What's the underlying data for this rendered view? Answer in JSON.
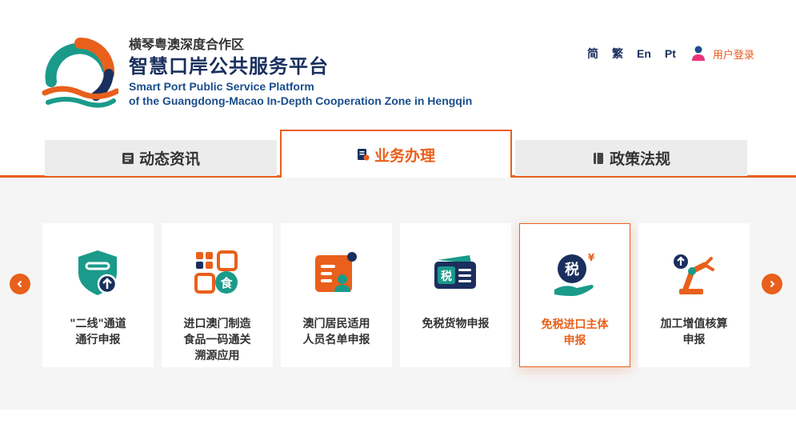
{
  "header": {
    "org_name": "横琴粤澳深度合作区",
    "platform_name": "智慧口岸公共服务平台",
    "en_line1": "Smart Port Public Service Platform",
    "en_line2": "of the Guangdong-Macao In-Depth Cooperation Zone in Hengqin",
    "languages": [
      "简",
      "繁",
      "En",
      "Pt"
    ],
    "login_label": "用户登录"
  },
  "tabs": [
    {
      "label": "动态资讯",
      "icon": "news-icon",
      "active": false
    },
    {
      "label": "业务办理",
      "icon": "business-doc-icon",
      "active": true
    },
    {
      "label": "政策法规",
      "icon": "book-icon",
      "active": false
    }
  ],
  "services": [
    {
      "label": "\"二线\"通道\n通行申报",
      "icon": "shield-upload-icon",
      "active": false
    },
    {
      "label": "进口澳门制造\n食品一码通关\n溯源应用",
      "icon": "qr-food-icon",
      "active": false
    },
    {
      "label": "澳门居民适用\n人员名单申报",
      "icon": "resident-list-icon",
      "active": false
    },
    {
      "label": "免税货物申报",
      "icon": "tax-ticket-icon",
      "active": false
    },
    {
      "label": "免税进口主体\n申报",
      "icon": "tax-hand-icon",
      "active": true
    },
    {
      "label": "加工增值核算\n申报",
      "icon": "robot-arm-icon",
      "active": false
    }
  ],
  "colors": {
    "accent": "#e8601c",
    "navy": "#1a2f5e",
    "teal": "#1a9a8a",
    "blue": "#1a4e8c"
  }
}
